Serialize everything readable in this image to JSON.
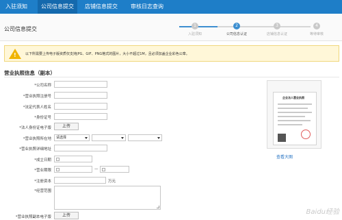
{
  "nav": {
    "tabs": [
      {
        "label": "入驻须知"
      },
      {
        "label": "公司信息提交"
      },
      {
        "label": "店铺信息提交"
      },
      {
        "label": "审核日志查询"
      }
    ]
  },
  "header": {
    "title": "公司信息提交",
    "steps": [
      {
        "num": "1",
        "label": "入驻须知"
      },
      {
        "num": "2",
        "label": "公司信息认证"
      },
      {
        "num": "3",
        "label": "店铺信息认证"
      },
      {
        "num": "4",
        "label": "等待审核"
      }
    ]
  },
  "notice": {
    "text": "以下所需要上传电子版资质仅支持JPG、GIF、PNG格式的图片，大小不超过1M，且必须加盖企业彩色公章。"
  },
  "section": {
    "title": "营业执照信息（副本）"
  },
  "form": {
    "company_name": "*公司名称",
    "reg_no": "*营业执照注册号",
    "legal_rep": "*法定代表人姓名",
    "id_no": "*身份证号",
    "id_upload": "*法人身份证电子版",
    "upload_label": "上传",
    "location": "*营业执照所在地",
    "location_placeholder": "请选择",
    "address": "*营业执照详细地址",
    "founded": "*成立日期",
    "term": "*营业期限",
    "term_sep": "—",
    "capital": "*注册资本",
    "capital_unit": "万元",
    "scope": "*经营范围",
    "license_upload": "*营业执照副本电子版",
    "upload_label2": "上传"
  },
  "preview": {
    "license_title": "企业法人营业执照",
    "view_large": "查看大图"
  },
  "watermark": {
    "text": "Baidu经验"
  }
}
